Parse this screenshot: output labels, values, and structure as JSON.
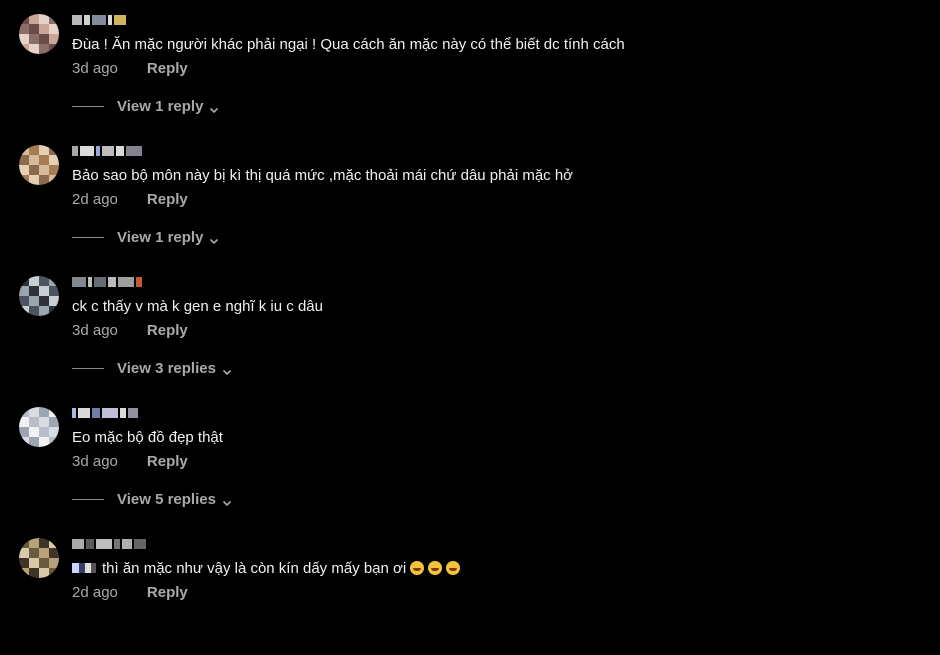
{
  "comments": [
    {
      "text": "Đùa ! Ăn mặc người khác phải ngại ! Qua cách ăn mặc này có thể biết dc tính cách",
      "time": "3d ago",
      "reply_label": "Reply",
      "view_replies": "View 1 reply",
      "avatar_colors": [
        "#6b4a4a",
        "#caa59a",
        "#e7d2c9",
        "#8d6d68"
      ],
      "username_colors": [
        "#d8d8d8",
        "#f5f5f5",
        "#9aa3b5",
        "#ffffff",
        "#f2d46a"
      ]
    },
    {
      "text": "Bảo sao bộ môn này bị kì thị quá mức ,mặc thoải mái chứ dâu phải mặc hở",
      "time": "2d ago",
      "reply_label": "Reply",
      "view_replies": "View 1 reply",
      "avatar_colors": [
        "#8b6a4e",
        "#d8b99a",
        "#a67c55",
        "#e6cfb2"
      ],
      "username_colors": [
        "#c5c5c5",
        "#ffffff",
        "#b7c3ff",
        "#dddddd",
        "#ffffff",
        "#9999aa"
      ]
    },
    {
      "text": "ck c thấy v mà k gen e nghĩ k iu c dâu",
      "time": "3d ago",
      "reply_label": "Reply",
      "view_replies": "View 3 replies",
      "avatar_colors": [
        "#4a5560",
        "#9aa5ad",
        "#2e3339",
        "#c8cfd3"
      ],
      "username_colors": [
        "#9aa0aa",
        "#e0e0e0",
        "#7a7f8a",
        "#dddddd",
        "#bbbbbb",
        "#e86a3a"
      ]
    },
    {
      "text": "Eo mặc bộ đồ đẹp thật",
      "time": "3d ago",
      "reply_label": "Reply",
      "view_replies": "View 5 replies",
      "avatar_colors": [
        "#d8dbe0",
        "#9da5b0",
        "#f1f1f1",
        "#b8bec8"
      ],
      "username_colors": [
        "#cfd6ff",
        "#ffffff",
        "#8890c0",
        "#e0e0ff",
        "#ffffff",
        "#aab"
      ]
    },
    {
      "text": "thì ăn mặc như vậy là còn kín dấy mấy bạn ơi",
      "time": "2d ago",
      "reply_label": "Reply",
      "emojis": [
        "rofl-emoji",
        "rofl-emoji",
        "rofl-emoji"
      ],
      "avatar_colors": [
        "#6a5a40",
        "#b8a27c",
        "#3e3428",
        "#d8c9a8"
      ],
      "username_colors": [
        "#c8c8c8",
        "#6a6a6a",
        "#e0e0e0",
        "#8a8a8a",
        "#cfcfcf",
        "#777"
      ]
    }
  ]
}
